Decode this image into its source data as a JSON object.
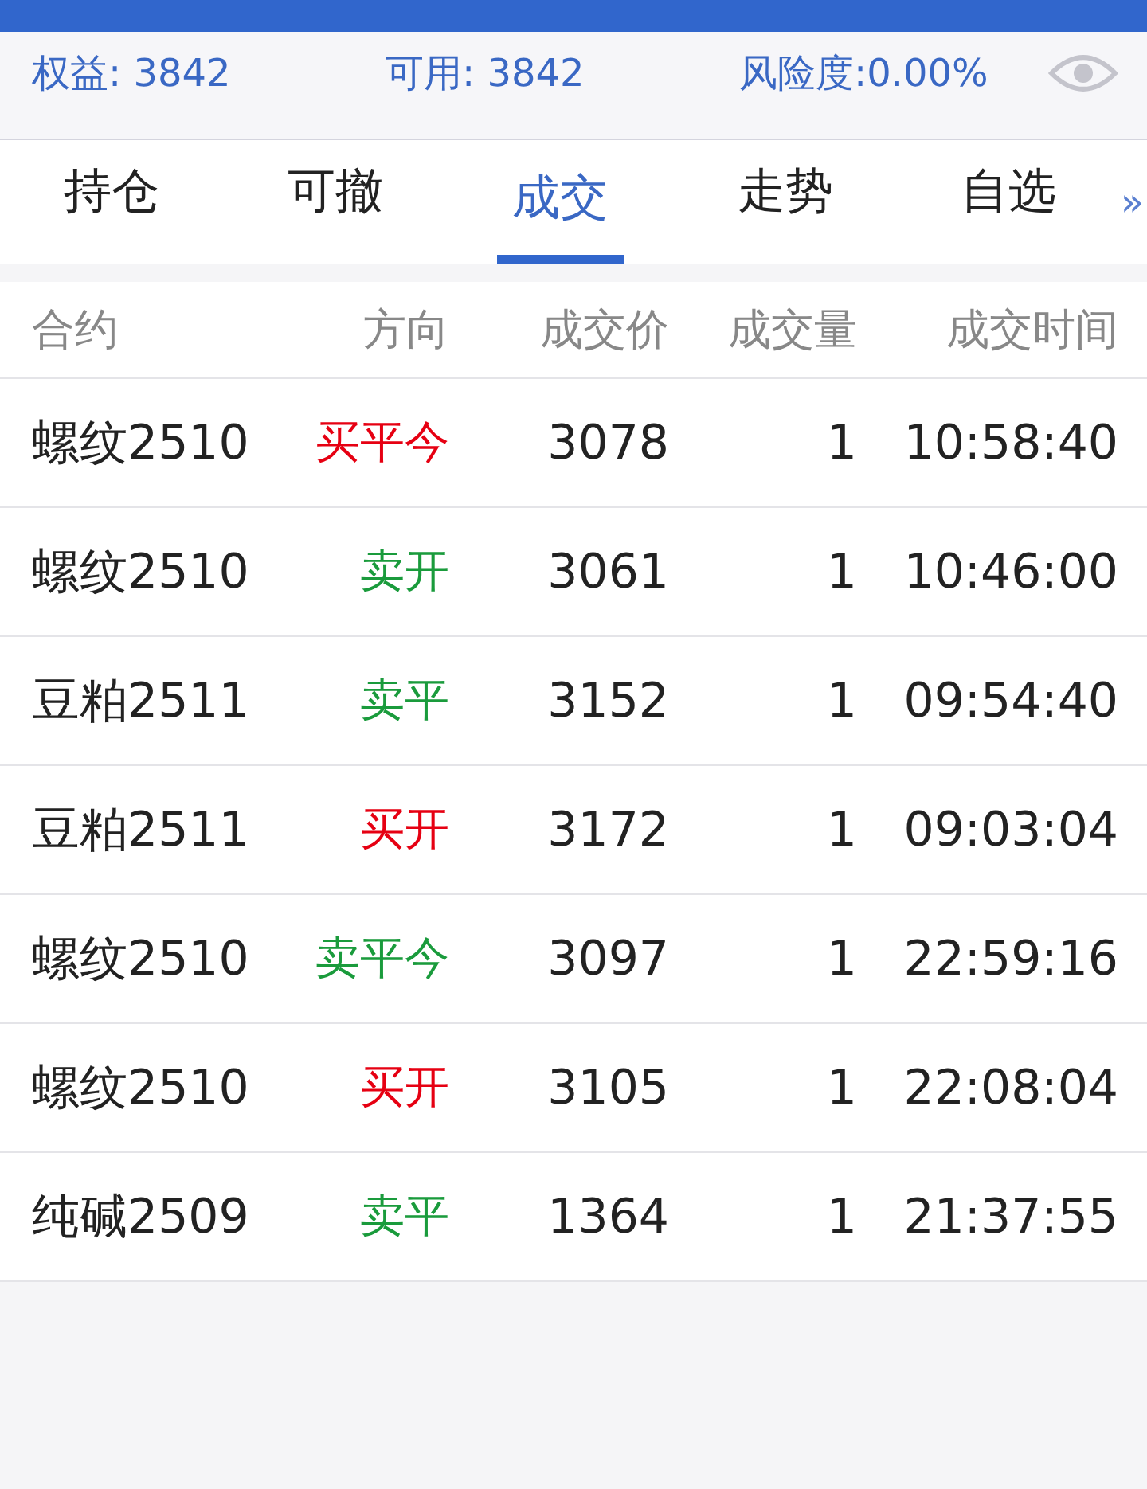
{
  "account": {
    "equity": "权益: 3842",
    "available": "可用: 3842",
    "risk": "风险度:0.00%"
  },
  "tabs": [
    {
      "label": "持仓",
      "selected": false
    },
    {
      "label": "可撤",
      "selected": false
    },
    {
      "label": "成交",
      "selected": true
    },
    {
      "label": "走势",
      "selected": false
    },
    {
      "label": "自选",
      "selected": false
    }
  ],
  "tabs_more": "»",
  "table": {
    "columns": [
      "合约",
      "方向",
      "成交价",
      "成交量",
      "成交时间"
    ],
    "rows": [
      {
        "contract": "螺纹2510",
        "direction": "买平今",
        "color": "#e60012",
        "price": "3078",
        "volume": "1",
        "time": "10:58:40"
      },
      {
        "contract": "螺纹2510",
        "direction": "卖开",
        "color": "#1a9b3c",
        "price": "3061",
        "volume": "1",
        "time": "10:46:00"
      },
      {
        "contract": "豆粕2511",
        "direction": "卖平",
        "color": "#1a9b3c",
        "price": "3152",
        "volume": "1",
        "time": "09:54:40"
      },
      {
        "contract": "豆粕2511",
        "direction": "买开",
        "color": "#e60012",
        "price": "3172",
        "volume": "1",
        "time": "09:03:04"
      },
      {
        "contract": "螺纹2510",
        "direction": "卖平今",
        "color": "#1a9b3c",
        "price": "3097",
        "volume": "1",
        "time": "22:59:16"
      },
      {
        "contract": "螺纹2510",
        "direction": "买开",
        "color": "#e60012",
        "price": "3105",
        "volume": "1",
        "time": "22:08:04"
      },
      {
        "contract": "纯碱2509",
        "direction": "卖平",
        "color": "#1a9b3c",
        "price": "1364",
        "volume": "1",
        "time": "21:37:55"
      }
    ]
  }
}
